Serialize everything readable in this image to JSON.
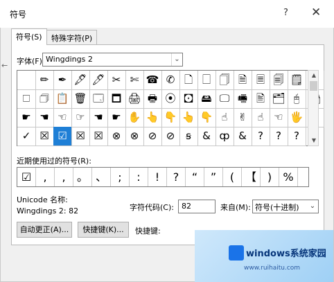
{
  "window": {
    "title": "符号",
    "help": "?",
    "close": "✕"
  },
  "tabs": [
    {
      "label": "符号(S)"
    },
    {
      "label": "特殊字符(P)"
    }
  ],
  "font": {
    "label": "字体(F):",
    "value": "Wingdings 2"
  },
  "grid_rows": [
    [
      "",
      "✏",
      "✒",
      "🖋",
      "🖊",
      "✂",
      "✄",
      "☎",
      "✆",
      "🗋",
      "🗌",
      "🗍",
      "🗎",
      "🗏",
      "🗐",
      "🗒",
      "🗅"
    ],
    [
      "🗆",
      "🗇",
      "📋",
      "🗑",
      "🗔",
      "🗖",
      "🖨",
      "🖶",
      "⦿",
      "🖸",
      "🖴",
      "🖵",
      "🖷",
      "🖹",
      "🗂",
      "🖰",
      "🗃"
    ],
    [
      "☛",
      "☚",
      "☜",
      "☞",
      "☚",
      "☛",
      "✋",
      "👆",
      "👇",
      "👆",
      "👇",
      "☝",
      "✌",
      "☝",
      "☜",
      "🖐",
      "✕"
    ],
    [
      "✓",
      "☒",
      "☑",
      "☒",
      "☒",
      "⊗",
      "⊗",
      "⊘",
      "⊘",
      "ꞩ",
      "&",
      "ȹ",
      "&",
      "?",
      "?",
      "?"
    ]
  ],
  "selected_cell": {
    "row": 3,
    "col": 2
  },
  "recent": {
    "label": "近期使用过的符号(R):",
    "items": [
      "☑",
      ",",
      ",",
      "。",
      "、",
      ";",
      ":",
      "!",
      "?",
      "“",
      "”",
      "(",
      "【",
      ")",
      "%"
    ]
  },
  "info": {
    "unicode_name_label": "Unicode 名称:",
    "unicode_value": "Wingdings 2: 82",
    "char_code_label": "字符代码(C):",
    "char_code": "82",
    "from_label": "来自(M):",
    "from_value": "符号(十进制)"
  },
  "buttons": {
    "autocorrect": "自动更正(A)...",
    "shortcut": "快捷键(K)...",
    "shortcut_label": "快捷键:"
  },
  "watermark": {
    "brand": "windows系统家园",
    "url": "www.ruihaitu.com"
  }
}
